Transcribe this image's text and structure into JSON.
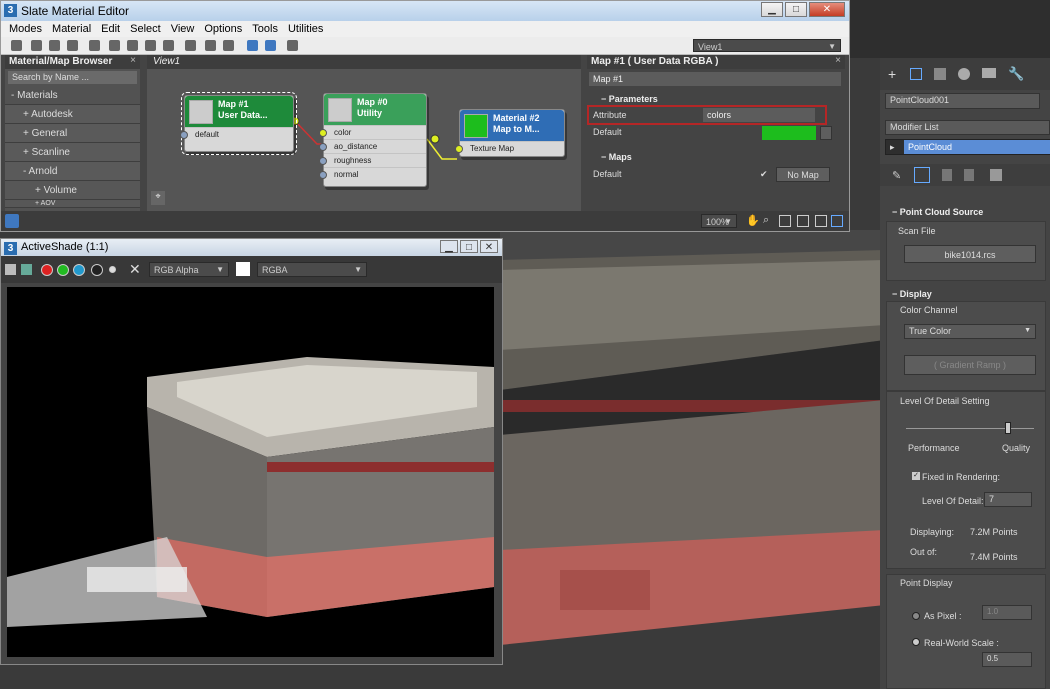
{
  "slate": {
    "title": "Slate Material Editor",
    "menu": [
      "Modes",
      "Material",
      "Edit",
      "Select",
      "View",
      "Options",
      "Tools",
      "Utilities"
    ],
    "view_dropdown": "View1",
    "browser": {
      "title": "Material/Map Browser",
      "search_placeholder": "Search by Name ...",
      "items": [
        "- Materials",
        "+ Autodesk",
        "+ General",
        "+ Scanline",
        "- Arnold",
        "+ Volume",
        "+ AOV"
      ]
    },
    "view_tab": "View1",
    "nodes": {
      "map1": {
        "title1": "Map #1",
        "title2": "User Data...",
        "port": "default"
      },
      "map0": {
        "title1": "Map #0",
        "title2": "Utility",
        "ports": [
          "color",
          "ao_distance",
          "roughness",
          "normal"
        ]
      },
      "mat2": {
        "title1": "Material #2",
        "title2": "Map to M...",
        "port": "Texture Map"
      }
    },
    "params": {
      "header": "Map #1  ( User Data RGBA )",
      "name_field": "Map #1",
      "section_parameters": "Parameters",
      "attribute_label": "Attribute",
      "attribute_value": "colors",
      "default_label": "Default",
      "default_color": "#1dbd1d",
      "section_maps": "Maps",
      "maps_default_label": "Default",
      "maps_check": "✔",
      "no_map": "No Map"
    },
    "zoom": "100%"
  },
  "shade": {
    "title": "ActiveShade (1:1)",
    "channel_dropdown": "RGB Alpha",
    "mode_dropdown": "RGBA"
  },
  "cmd": {
    "object_name": "PointCloud001",
    "modifier_list": "Modifier List",
    "stack_item": "PointCloud",
    "point_cloud_source": "Point Cloud Source",
    "scan_file_label": "Scan File",
    "scan_file": "bike1014.rcs",
    "display": "Display",
    "color_channel_label": "Color Channel",
    "color_channel": "True Color",
    "gradient_ramp": "( Gradient Ramp )",
    "lod_setting": "Level Of Detail Setting",
    "performance": "Performance",
    "quality": "Quality",
    "lod_level": 0.8,
    "fixed_in_rendering": "Fixed in Rendering:",
    "lod_label": "Level Of Detail:",
    "lod_value": "7",
    "displaying_label": "Displaying:",
    "displaying_value": "7.2M Points",
    "outof_label": "Out of:",
    "outof_value": "7.4M Points",
    "point_display": "Point Display",
    "as_pixel": "As Pixel :",
    "as_pixel_value": "1.0",
    "real_world": "Real-World Scale :",
    "real_world_value": "0.5"
  }
}
